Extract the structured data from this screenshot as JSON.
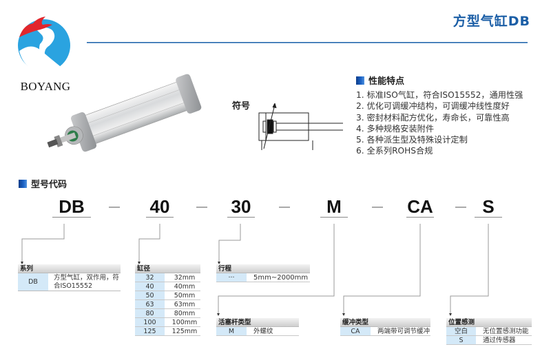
{
  "header": {
    "brand": "BOYANG",
    "title": "方型气缸DB",
    "brand_colors": {
      "red": "#e2262c",
      "blue": "#2aa3e0",
      "title_blue": "#1b5ea6"
    }
  },
  "symbol": {
    "label": "符号"
  },
  "features": {
    "heading": "性能特点",
    "items": [
      "1. 标准ISO气缸，符合ISO15552，通用性强",
      "2. 优化可调缓冲结构，可调缓冲线性度好",
      "3. 密封材料配方优化，寿命长，可靠性高",
      "4. 多种规格安装附件",
      "5. 各种派生型及特殊设计定制",
      "6. 全系列ROHS合规"
    ]
  },
  "model_code": {
    "heading": "型号代码",
    "parts": [
      "DB",
      "40",
      "30",
      "M",
      "CA",
      "S"
    ],
    "tables": {
      "series": {
        "title": "系列",
        "rows": [
          {
            "code": "DB",
            "desc": "方型气缸，双作用，符合ISO15552"
          }
        ]
      },
      "bore": {
        "title": "缸径",
        "rows": [
          {
            "code": "32",
            "desc": "32mm"
          },
          {
            "code": "40",
            "desc": "40mm"
          },
          {
            "code": "50",
            "desc": "50mm"
          },
          {
            "code": "63",
            "desc": "63mm"
          },
          {
            "code": "80",
            "desc": "80mm"
          },
          {
            "code": "100",
            "desc": "100mm"
          },
          {
            "code": "125",
            "desc": "125mm"
          }
        ]
      },
      "stroke": {
        "title": "行程",
        "rows": [
          {
            "code": "···",
            "desc": "5mm~2000mm"
          }
        ]
      },
      "rod": {
        "title": "活塞杆类型",
        "rows": [
          {
            "code": "M",
            "desc": "外螺纹"
          }
        ]
      },
      "cushion": {
        "title": "缓冲类型",
        "rows": [
          {
            "code": "CA",
            "desc": "两端带可调节缓冲"
          }
        ]
      },
      "sensor": {
        "title": "位置感测",
        "rows": [
          {
            "code": "空白",
            "desc": "无位置感测功能"
          },
          {
            "code": "S",
            "desc": "通过传感器"
          }
        ]
      }
    }
  }
}
